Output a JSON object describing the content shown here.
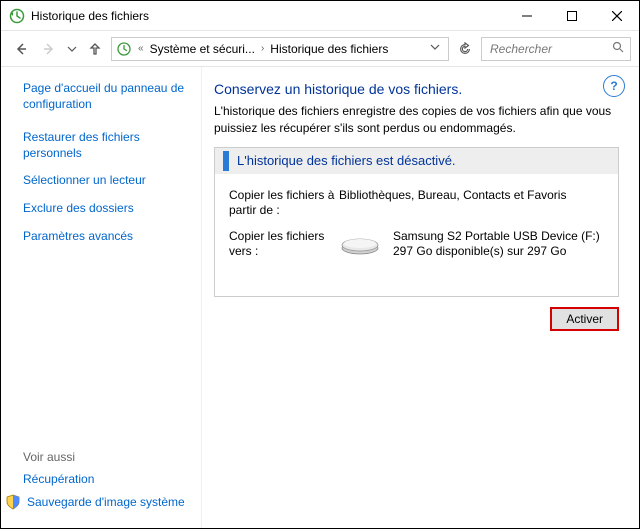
{
  "window": {
    "title": "Historique des fichiers"
  },
  "nav": {
    "crumb1": "Système et sécuri...",
    "crumb2": "Historique des fichiers"
  },
  "search": {
    "placeholder": "Rechercher"
  },
  "sidebar": {
    "link_home": "Page d'accueil du panneau de configuration",
    "link_restore": "Restaurer des fichiers personnels",
    "link_drive": "Sélectionner un lecteur",
    "link_exclude": "Exclure des dossiers",
    "link_advanced": "Paramètres avancés",
    "see_also": "Voir aussi",
    "link_recovery": "Récupération",
    "link_sysimage": "Sauvegarde d'image système"
  },
  "main": {
    "heading": "Conservez un historique de vos fichiers.",
    "subtext": "L'historique des fichiers enregistre des copies de vos fichiers afin que vous puissiez les récupérer s'ils sont perdus ou endommagés.",
    "status": "L'historique des fichiers est désactivé.",
    "from_label": "Copier les fichiers à partir de :",
    "from_value": "Bibliothèques, Bureau, Contacts et Favoris",
    "to_label": "Copier les fichiers vers :",
    "to_name": "Samsung S2 Portable USB Device (F:)",
    "to_space": "297 Go disponible(s) sur 297 Go",
    "activate": "Activer"
  }
}
